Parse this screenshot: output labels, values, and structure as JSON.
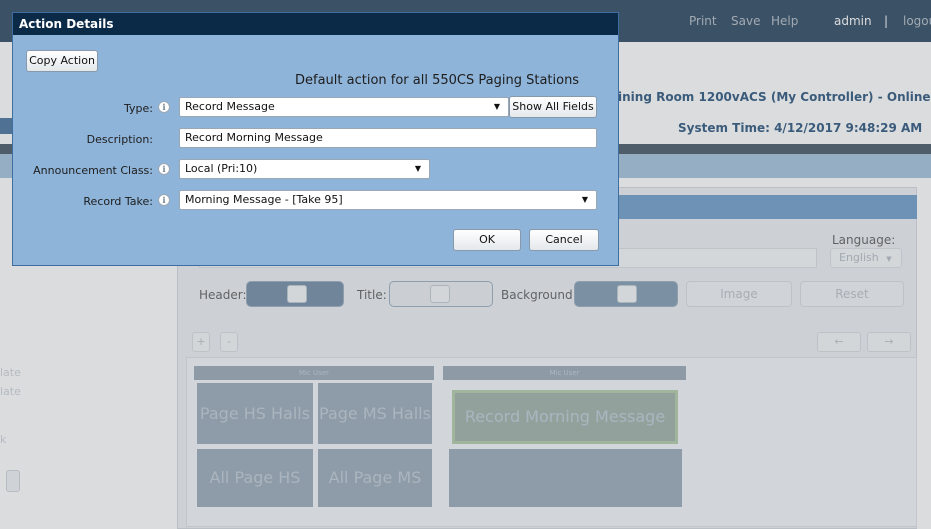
{
  "topnav": {
    "print": "Print",
    "save": "Save",
    "help": "Help",
    "user": "admin",
    "separator": "|",
    "logout": "logou"
  },
  "header": {
    "controller": "ining Room 1200vACS (My Controller) - Online",
    "system_time": "System Time: 4/12/2017 9:48:29 AM"
  },
  "sidebar_fragments": [
    "late",
    "late",
    "k"
  ],
  "editor": {
    "language_label": "Language:",
    "language_value": "English",
    "header_label": "Header:",
    "title_label": "Title:",
    "background_label": "Background:",
    "image_button": "Image",
    "reset_button": "Reset",
    "add_button": "+",
    "remove_button": "-",
    "prev_button": "←",
    "next_button": "→",
    "columns": [
      {
        "header": "Mic User",
        "tiles": [
          "Page HS Halls",
          "Page MS Halls",
          "All Page HS",
          "All Page MS"
        ]
      },
      {
        "header": "Mic User",
        "tiles": [
          "Record Morning Message",
          ""
        ]
      }
    ]
  },
  "dialog": {
    "title": "Action Details",
    "copy_action": "Copy Action",
    "subtitle": "Default action for all 550CS Paging Stations",
    "type_label": "Type:",
    "type_value": "Record Message",
    "show_all_fields": "Show All Fields",
    "description_label": "Description:",
    "description_value": "Record Morning Message",
    "announcement_label": "Announcement Class:",
    "announcement_value": "Local (Pri:10)",
    "record_take_label": "Record Take:",
    "record_take_value": "Morning Message - [Take 95]",
    "ok": "OK",
    "cancel": "Cancel"
  }
}
